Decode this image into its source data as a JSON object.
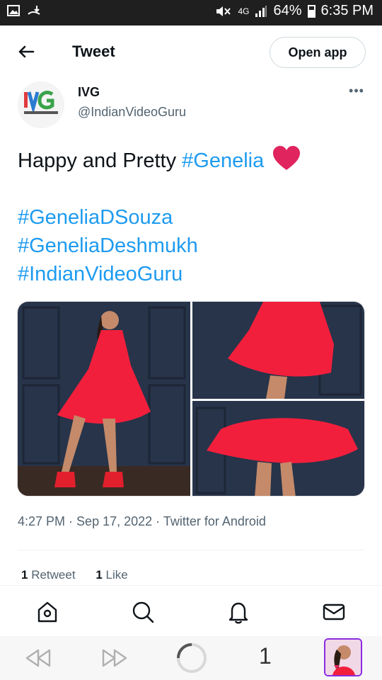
{
  "status_bar": {
    "network": "4G",
    "battery": "64%",
    "time": "6:35 PM"
  },
  "header": {
    "title": "Tweet",
    "open_app_label": "Open app"
  },
  "author": {
    "avatar_logo_text": "IVG",
    "avatar_logo_subtext": "INDIAN VIDEO GURU",
    "name": "IVG",
    "handle": "@IndianVideoGuru",
    "more_label": "•••"
  },
  "tweet": {
    "text_before_tag": "Happy and Pretty ",
    "inline_tag": "#Genelia",
    "emoji": "❤️",
    "hashtags": [
      "#GeneliaDSouza",
      "#GeneliaDeshmukh",
      "#IndianVideoGuru"
    ]
  },
  "meta": {
    "time": "4:27 PM",
    "separator": " · ",
    "date": "Sep 17, 2022",
    "source": "Twitter for Android"
  },
  "stats": {
    "retweets_count": "1",
    "retweets_label": "Retweet",
    "likes_count": "1",
    "likes_label": "Like"
  },
  "browser": {
    "tab_count": "1"
  },
  "colors": {
    "link": "#1d9bf0",
    "dress": "#f21f3c",
    "wall": "#27344a",
    "heart": "#e0245e"
  }
}
